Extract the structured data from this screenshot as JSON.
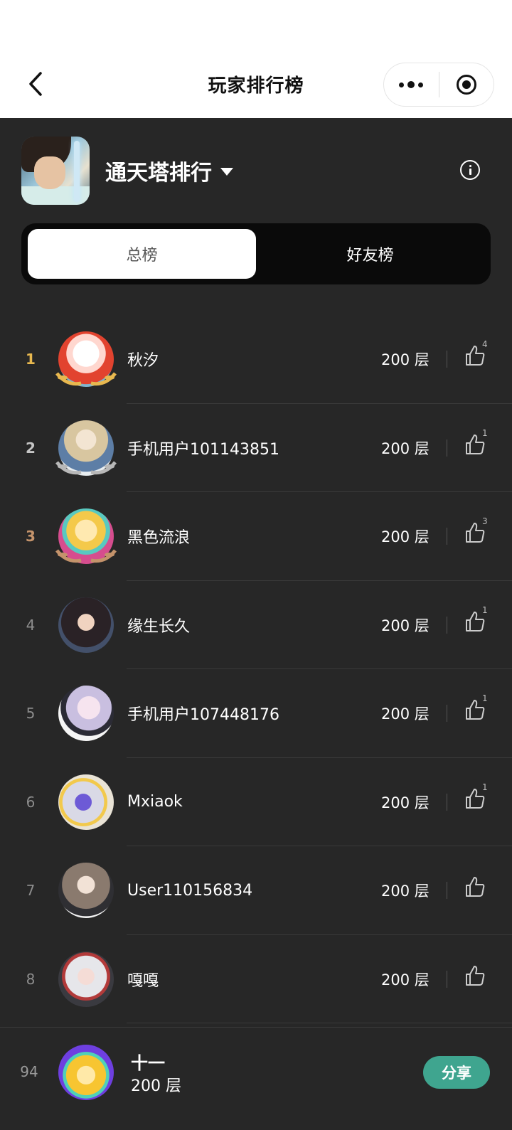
{
  "nav": {
    "title": "玩家排行榜",
    "more_icon": "more-dots-icon",
    "close_icon": "target-icon",
    "back_icon": "chevron-left-icon"
  },
  "game": {
    "title": "通天塔排行",
    "info_icon": "info-icon",
    "dropdown_icon": "caret-down-icon"
  },
  "tabs": [
    {
      "label": "总榜",
      "active": true
    },
    {
      "label": "好友榜",
      "active": false
    }
  ],
  "rankings": [
    {
      "rank": "1",
      "name": "秋汐",
      "score": "200 层",
      "likes": "4"
    },
    {
      "rank": "2",
      "name": "手机用户101143851",
      "score": "200 层",
      "likes": "1"
    },
    {
      "rank": "3",
      "name": "黑色流浪",
      "score": "200 层",
      "likes": "3"
    },
    {
      "rank": "4",
      "name": "缘生长久",
      "score": "200 层",
      "likes": "1"
    },
    {
      "rank": "5",
      "name": "手机用户107448176",
      "score": "200 层",
      "likes": "1"
    },
    {
      "rank": "6",
      "name": "Mxiaok",
      "score": "200 层",
      "likes": "1"
    },
    {
      "rank": "7",
      "name": "User110156834",
      "score": "200 层",
      "likes": ""
    },
    {
      "rank": "8",
      "name": "嘎嘎",
      "score": "200 层",
      "likes": ""
    }
  ],
  "me": {
    "rank": "94",
    "name": "十一",
    "score": "200 层",
    "share_label": "分享"
  },
  "colors": {
    "gold": "#e8b84f",
    "silver": "#c5c5c5",
    "bronze": "#c4936b",
    "share": "#3fa58f",
    "background": "#272727"
  }
}
